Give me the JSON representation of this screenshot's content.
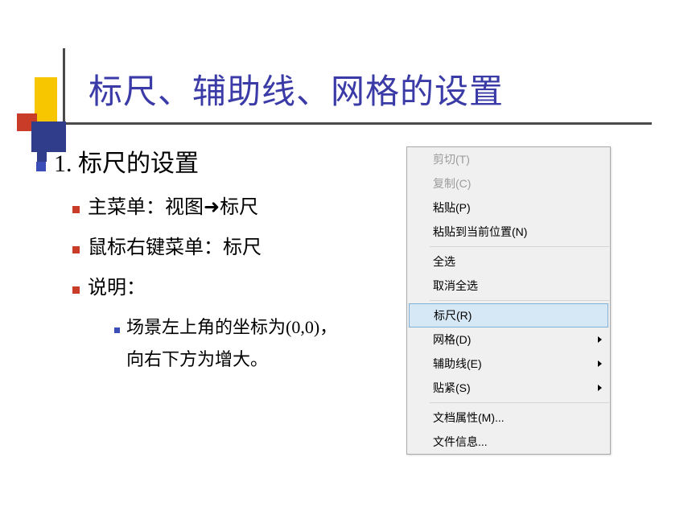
{
  "title": "标尺、辅助线、网格的设置",
  "section": {
    "number": "1.",
    "heading": "标尺的设置",
    "items": [
      {
        "prefix": "主菜单：视图",
        "arrow": "→",
        "suffix": "标尺"
      },
      {
        "text": "鼠标右键菜单：标尺"
      },
      {
        "text": "说明："
      }
    ],
    "nested": {
      "line1": "场景左上角的坐标为(0,0)，",
      "line2": "向右下方为增大。"
    }
  },
  "menu": {
    "items": [
      {
        "label": "剪切(T)",
        "disabled": true
      },
      {
        "label": "复制(C)",
        "disabled": true
      },
      {
        "label": "粘贴(P)",
        "disabled": false
      },
      {
        "label": "粘贴到当前位置(N)",
        "disabled": false
      },
      {
        "sep": true
      },
      {
        "label": "全选",
        "disabled": false
      },
      {
        "label": "取消全选",
        "disabled": false
      },
      {
        "sep": true
      },
      {
        "label": "标尺(R)",
        "disabled": false,
        "hover": true
      },
      {
        "label": "网格(D)",
        "disabled": false,
        "submenu": true
      },
      {
        "label": "辅助线(E)",
        "disabled": false,
        "submenu": true
      },
      {
        "label": "贴紧(S)",
        "disabled": false,
        "submenu": true
      },
      {
        "sep": true
      },
      {
        "label": "文档属性(M)...",
        "disabled": false
      },
      {
        "label": "文件信息...",
        "disabled": false
      }
    ]
  }
}
